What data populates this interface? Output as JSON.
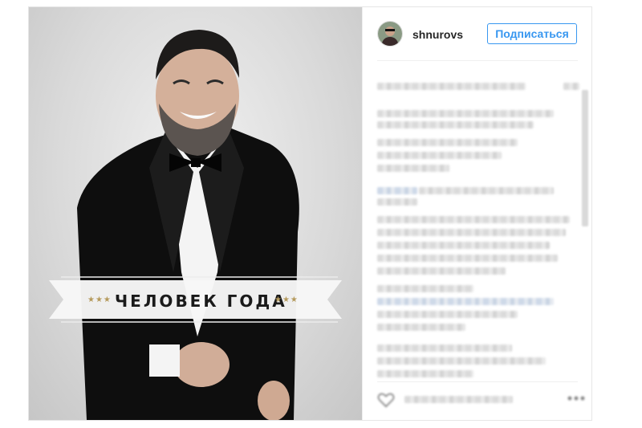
{
  "profile": {
    "username": "shnurovs",
    "avatar_icon": "user-avatar-icon"
  },
  "header": {
    "follow_label": "Подписаться"
  },
  "photo": {
    "banner_text": "ЧЕЛОВЕК ГОДА",
    "banner_stars_left": "★★★",
    "banner_stars_right": "★★★"
  },
  "colors": {
    "accent": "#3897f0",
    "username": "#262626",
    "banner_text": "#1a1a1a",
    "banner_stars": "#b59a5c"
  },
  "icons": {
    "like": "heart-icon",
    "options": "more-icon"
  }
}
